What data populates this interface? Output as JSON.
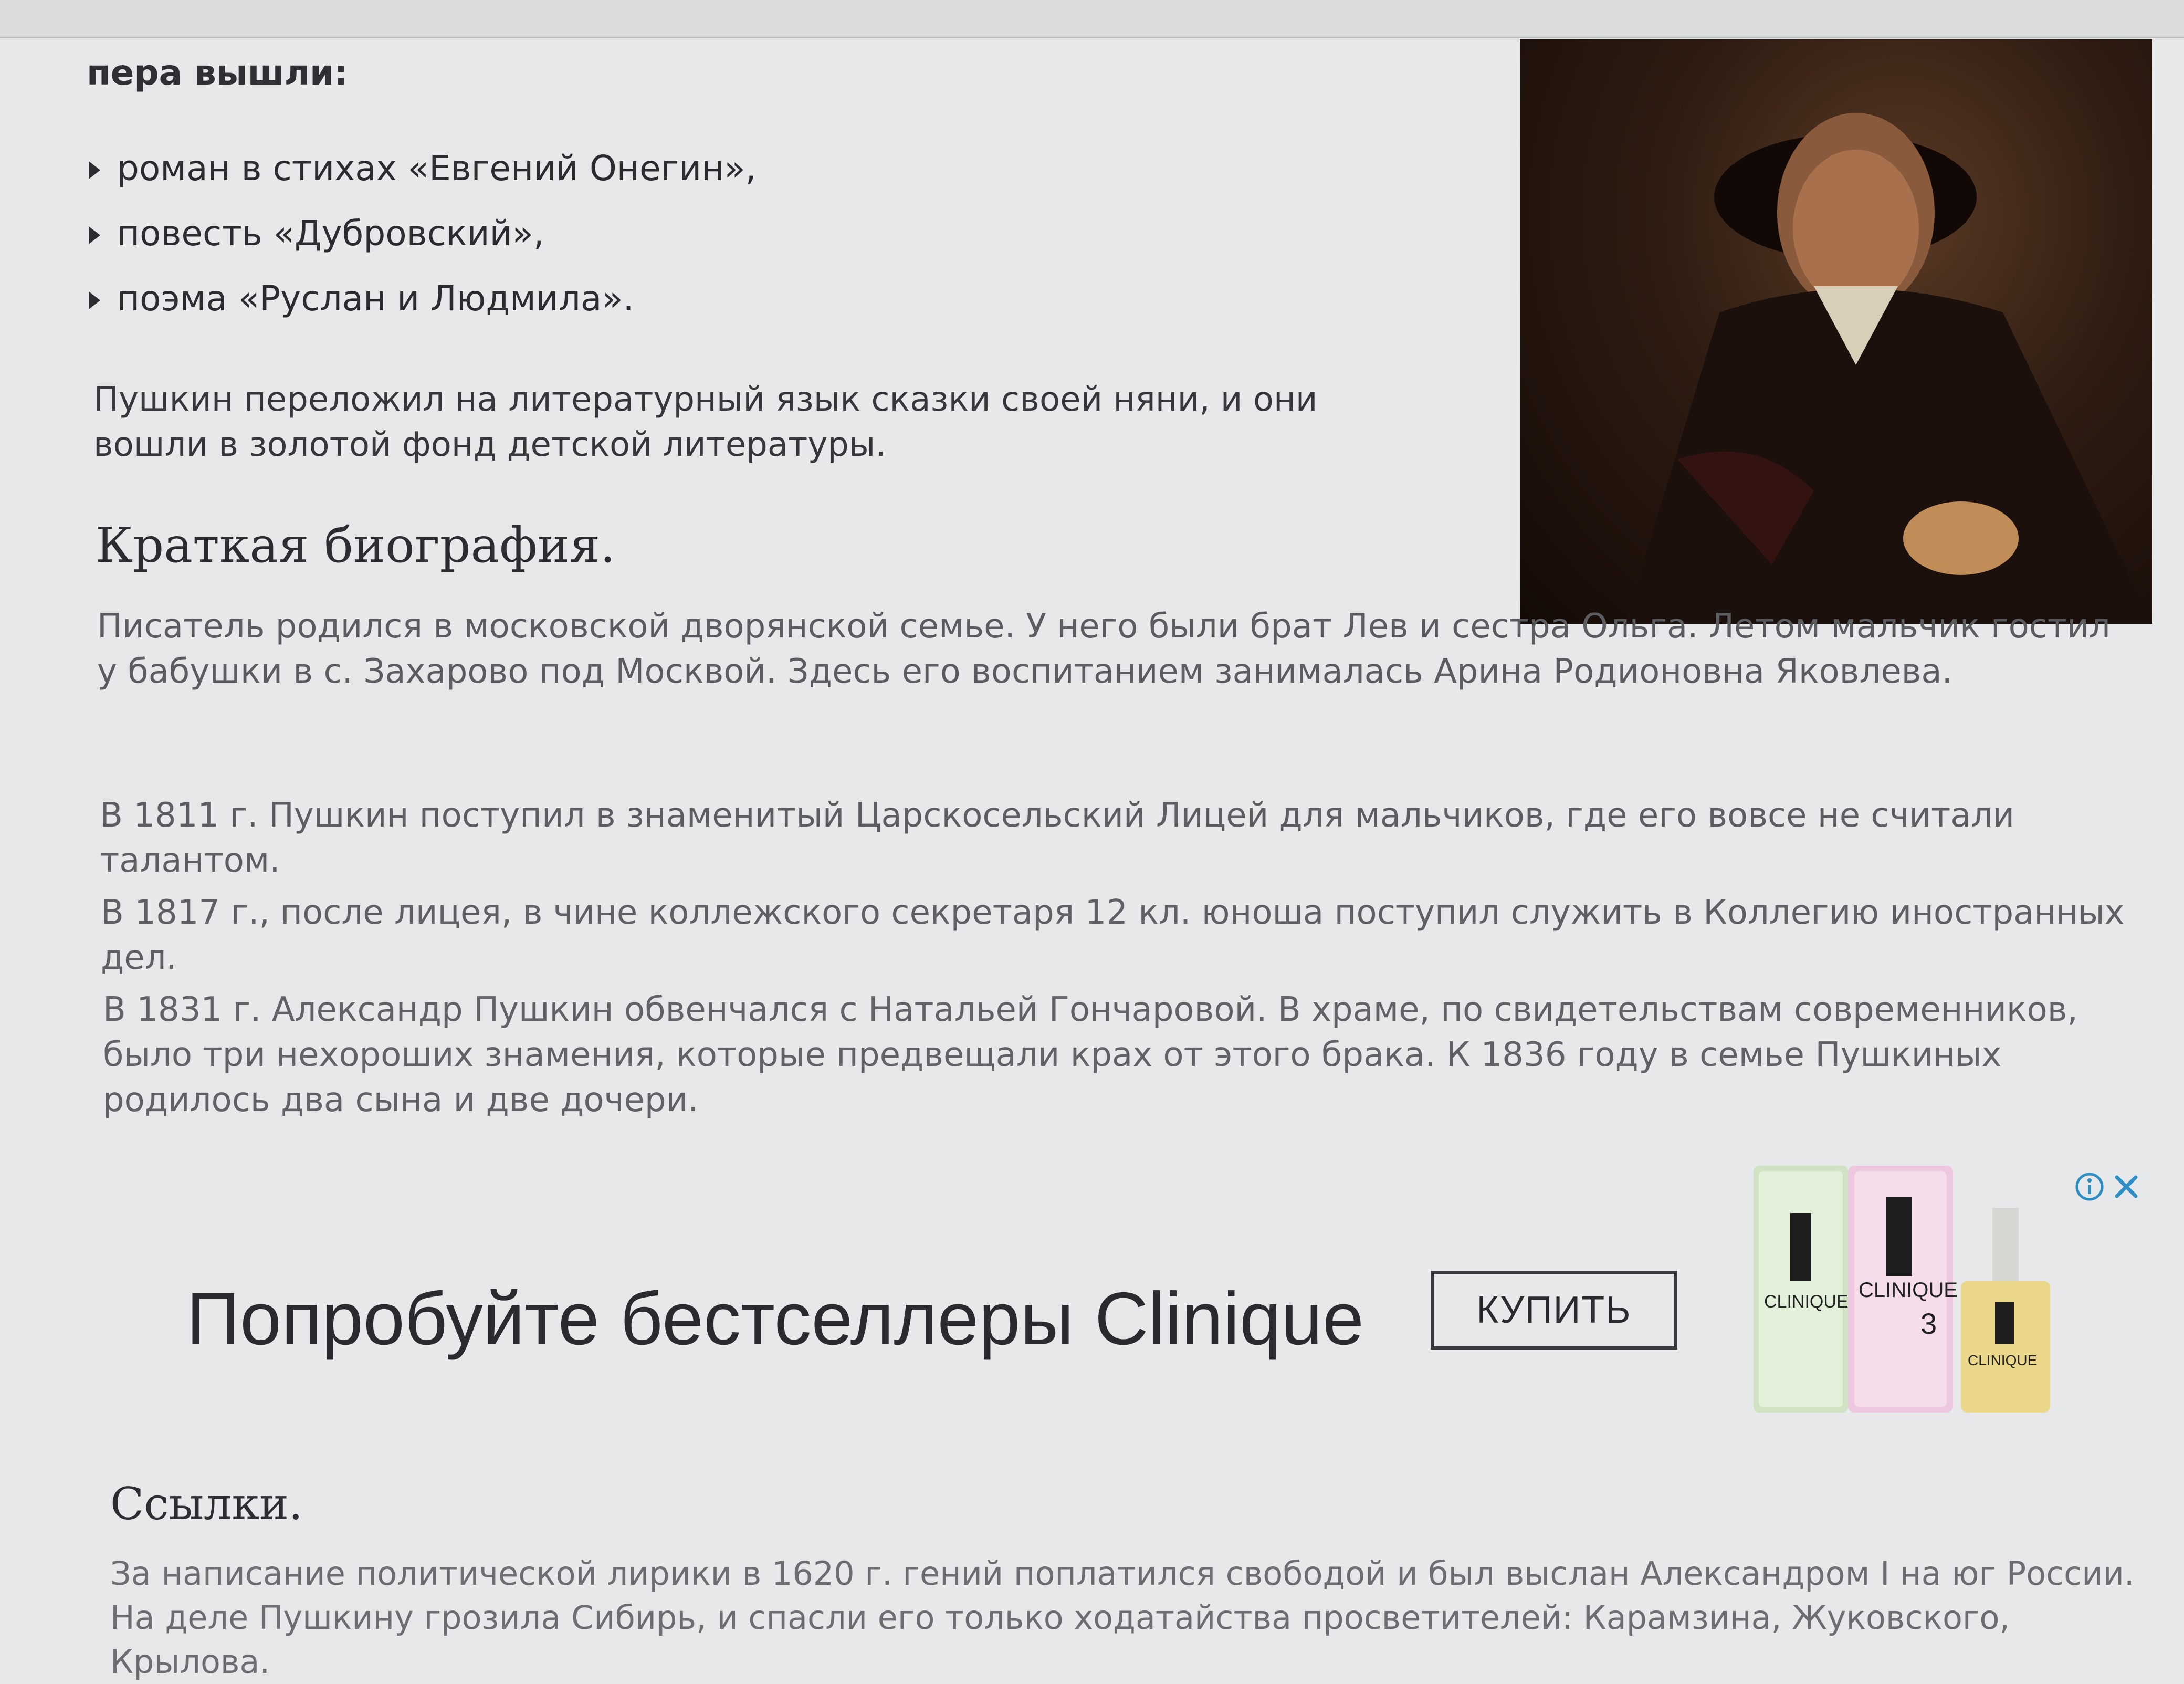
{
  "article": {
    "intro_tail": "пера вышли:",
    "works": [
      "роман в стихах «Евгений Онегин»,",
      "повесть «Дубровский»,",
      "поэма «Руслан и Людмила»."
    ],
    "fairy_tales_paragraph": "Пушкин переложил на литературный язык сказки своей няни, и они вошли в золотой фонд детской литературы.",
    "bio_heading": "Краткая биография.",
    "bio_paragraphs": [
      "Писатель родился в московской дворянской семье. У него были брат Лев и сестра Ольга. Летом мальчик гостил у бабушки в с. Захарово под Москвой. Здесь его воспитанием занималась Арина Родионовна Яковлева.",
      "В 1811 г. Пушкин поступил в знаменитый Царскосельский Лицей для мальчиков, где его вовсе не считали талантом.",
      "В 1817 г., после лицея, в чине коллежского секретаря 12 кл. юноша поступил служить в Коллегию иностранных дел.",
      "В 1831 г. Александр Пушкин обвенчался с Натальей Гончаровой. В храме, по свидетельствам современников, было три нехороших знамения, которые предвещали крах от этого брака. К 1836 году в семье Пушкиных родилось два сына и две дочери."
    ],
    "links_heading": "Ссылки.",
    "links_paragraph": "За написание политической лирики в 1620 г. гений поплатился свободой и был выслан Александром I на юг России. На деле Пушкину грозила Сибирь, и спасли его только ходатайства просветителей: Карамзина, Жуковского, Крылова."
  },
  "ad": {
    "text": "Попробуйте бестселлеры Clinique",
    "button_label": "КУПИТЬ",
    "product_brand": "CLINIQUE",
    "product_number": "3",
    "info_icon": "info-icon",
    "close_icon": "close-icon"
  },
  "colors": {
    "page_background": "#e6e8ea",
    "text_dark": "#2b2c2f",
    "text_gray": "#5c5e62"
  }
}
